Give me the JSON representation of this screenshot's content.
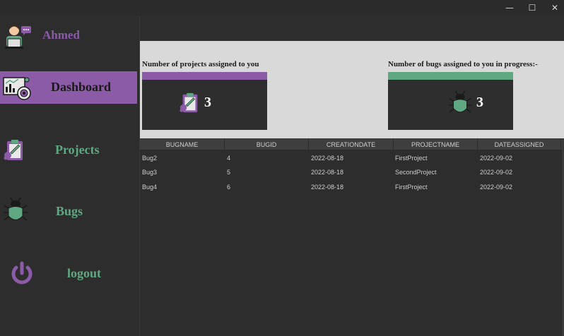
{
  "window": {
    "controls": {
      "minimize": "—",
      "maximize": "☐",
      "close": "✕"
    }
  },
  "sidebar": {
    "user_name": "Ahmed",
    "items": [
      {
        "label": "Dashboard",
        "active": true
      },
      {
        "label": "Projects",
        "active": false
      },
      {
        "label": "Bugs",
        "active": false
      },
      {
        "label": "logout",
        "active": false
      }
    ]
  },
  "cards": {
    "projects": {
      "title": "Number of projects assigned to you",
      "count": "3",
      "accent": "#8b5ba7"
    },
    "bugs": {
      "title": "Number of bugs assigned to you in progress:-",
      "count": "3",
      "accent": "#5fa882"
    }
  },
  "colors": {
    "purple": "#8b5ba7",
    "green": "#5fa882",
    "dark": "#2d2d2d"
  },
  "table": {
    "columns": [
      "BUGNAME",
      "BUGID",
      "CREATIONDATE",
      "PROJECTNAME",
      "DATEASSIGNED"
    ],
    "rows": [
      [
        "Bug2",
        "4",
        "2022-08-18",
        "FirstProject",
        "2022-09-02"
      ],
      [
        "Bug3",
        "5",
        "2022-08-18",
        "SecondProject",
        "2022-09-02"
      ],
      [
        "Bug4",
        "6",
        "2022-08-18",
        "FirstProject",
        "2022-09-02"
      ]
    ]
  }
}
